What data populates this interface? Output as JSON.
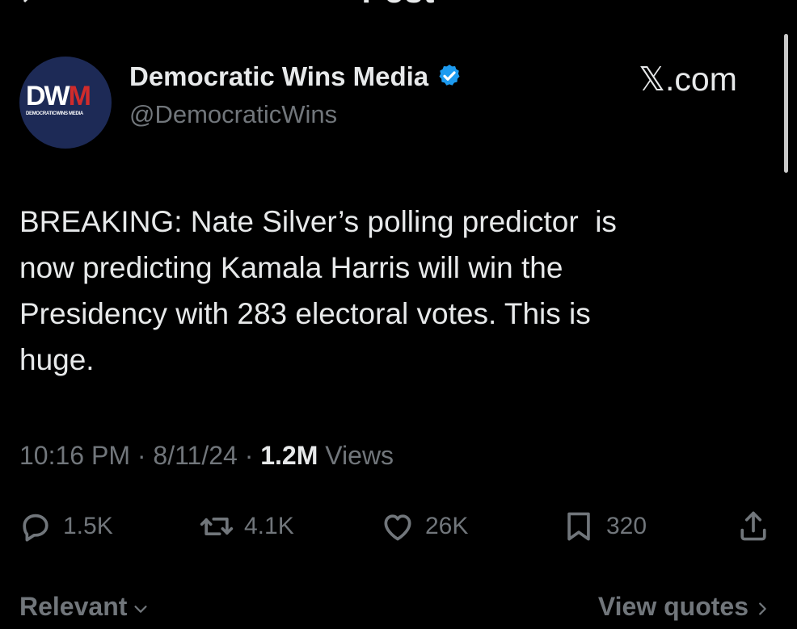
{
  "header": {
    "title": "Post"
  },
  "author": {
    "avatar_text_main": "DW",
    "avatar_text_accent": "M",
    "avatar_subtext": "DEMOCRATICWINS MEDIA",
    "display_name": "Democratic Wins Media",
    "handle": "@DemocraticWins",
    "verified": true,
    "badge_color": "#1d9bf0"
  },
  "watermark": "𝕏.com",
  "post": {
    "text": "BREAKING: Nate Silver’s polling predictor  is\nnow predicting Kamala Harris will win the\nPresidency with 283 electoral votes. This is\nhuge.",
    "time": "10:16 PM",
    "date": "8/11/24",
    "views_count": "1.2M",
    "views_label": "Views"
  },
  "actions": {
    "replies": {
      "icon": "reply-icon",
      "count": "1.5K"
    },
    "reposts": {
      "icon": "repost-icon",
      "count": "4.1K"
    },
    "likes": {
      "icon": "heart-icon",
      "count": "26K"
    },
    "bookmarks": {
      "icon": "bookmark-icon",
      "count": "320"
    },
    "share": {
      "icon": "share-icon"
    }
  },
  "footer": {
    "sort_label": "Relevant",
    "quotes_label": "View quotes"
  },
  "colors": {
    "background": "#000000",
    "text_primary": "#e7e9ea",
    "text_secondary": "#71767b",
    "avatar_bg": "#1d2a56",
    "avatar_accent": "#d12b2b"
  }
}
